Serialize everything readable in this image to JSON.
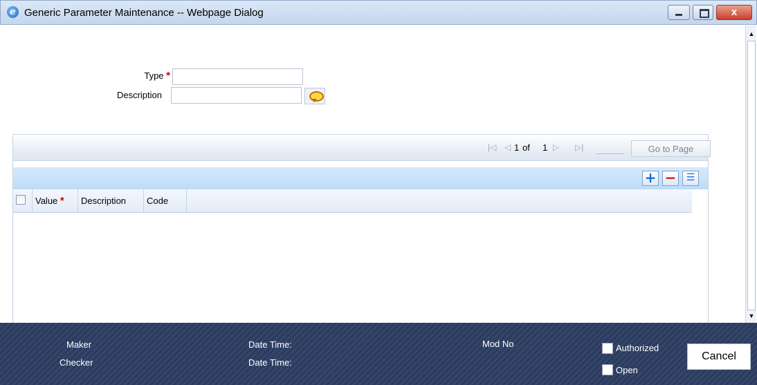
{
  "window": {
    "title": "Generic Parameter Maintenance -- Webpage Dialog",
    "close_glyph": "x",
    "icons": [
      "ie-icon",
      "minimize-icon",
      "maximize-icon",
      "close-icon"
    ],
    "ie_glyph": "e"
  },
  "form": {
    "type_label": "Type",
    "type_value": "",
    "description_label": "Description",
    "description_value": "",
    "required_mark": "*",
    "lov_icon": "speech-bubble-icon"
  },
  "pager": {
    "first_glyph": "|◁",
    "prev_glyph": "◁",
    "current": "1",
    "of_text": "of",
    "total": "1",
    "next_glyph": "▷",
    "last_glyph": "▷|",
    "goto_label": "Go to Page"
  },
  "grid": {
    "add_glyph": "+",
    "delete_glyph": "−",
    "view_glyph": "☰",
    "columns": [
      "Value",
      "Description",
      "Code"
    ],
    "required_mark": "*",
    "rows": []
  },
  "footer": {
    "maker_label": "Maker",
    "checker_label": "Checker",
    "date_time_label_1": "Date Time:",
    "date_time_label_2": "Date Time:",
    "mod_no_label": "Mod No",
    "authorized_label": "Authorized",
    "open_label": "Open",
    "cancel_label": "Cancel"
  },
  "colors": {
    "required": "#d00000",
    "footer_bg": "#2c3b5c",
    "grid_toolbar": "#bcdcf7"
  }
}
